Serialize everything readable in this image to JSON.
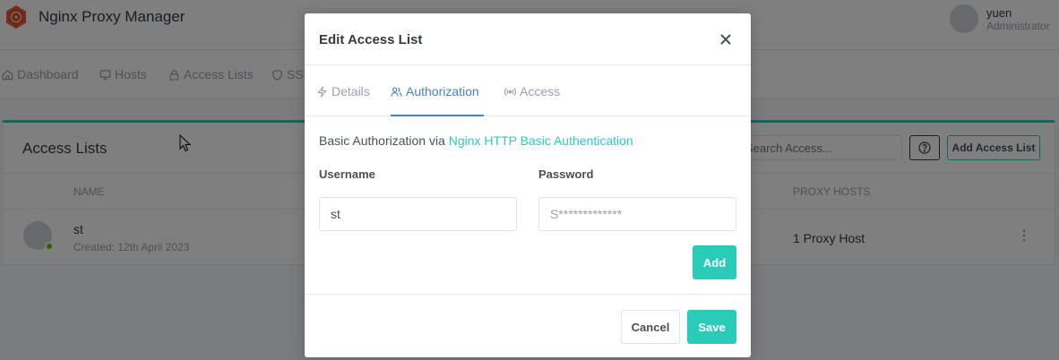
{
  "app": {
    "title": "Nginx Proxy Manager"
  },
  "user": {
    "name": "yuen",
    "role": "Administrator"
  },
  "nav": {
    "items": [
      {
        "label": "Dashboard",
        "icon": "home-icon"
      },
      {
        "label": "Hosts",
        "icon": "monitor-icon"
      },
      {
        "label": "Access Lists",
        "icon": "lock-icon"
      },
      {
        "label": "SSL",
        "icon": "shield-icon"
      }
    ]
  },
  "page": {
    "title": "Access Lists",
    "search_placeholder": "Search Access...",
    "add_button": "Add Access List",
    "columns": {
      "name": "NAME",
      "proxy_hosts": "PROXY HOSTS"
    },
    "rows": [
      {
        "name": "st",
        "created": "Created: 12th April 2023",
        "proxy_hosts": "1 Proxy Host",
        "status_color": "#5eba00"
      }
    ]
  },
  "modal": {
    "title": "Edit Access List",
    "tabs": [
      {
        "label": "Details",
        "icon": "bolt-icon"
      },
      {
        "label": "Authorization",
        "icon": "users-icon",
        "active": true
      },
      {
        "label": "Access",
        "icon": "radio-icon"
      }
    ],
    "auth_text_prefix": "Basic Authorization via ",
    "auth_link_text": "Nginx HTTP Basic Authentication",
    "username_label": "Username",
    "password_label": "Password",
    "username_value": "st",
    "password_placeholder": "S*************",
    "add_button": "Add",
    "cancel_button": "Cancel",
    "save_button": "Save"
  },
  "colors": {
    "accent": "#2bcbba",
    "active_tab": "#467fcf",
    "status_online": "#5eba00"
  }
}
